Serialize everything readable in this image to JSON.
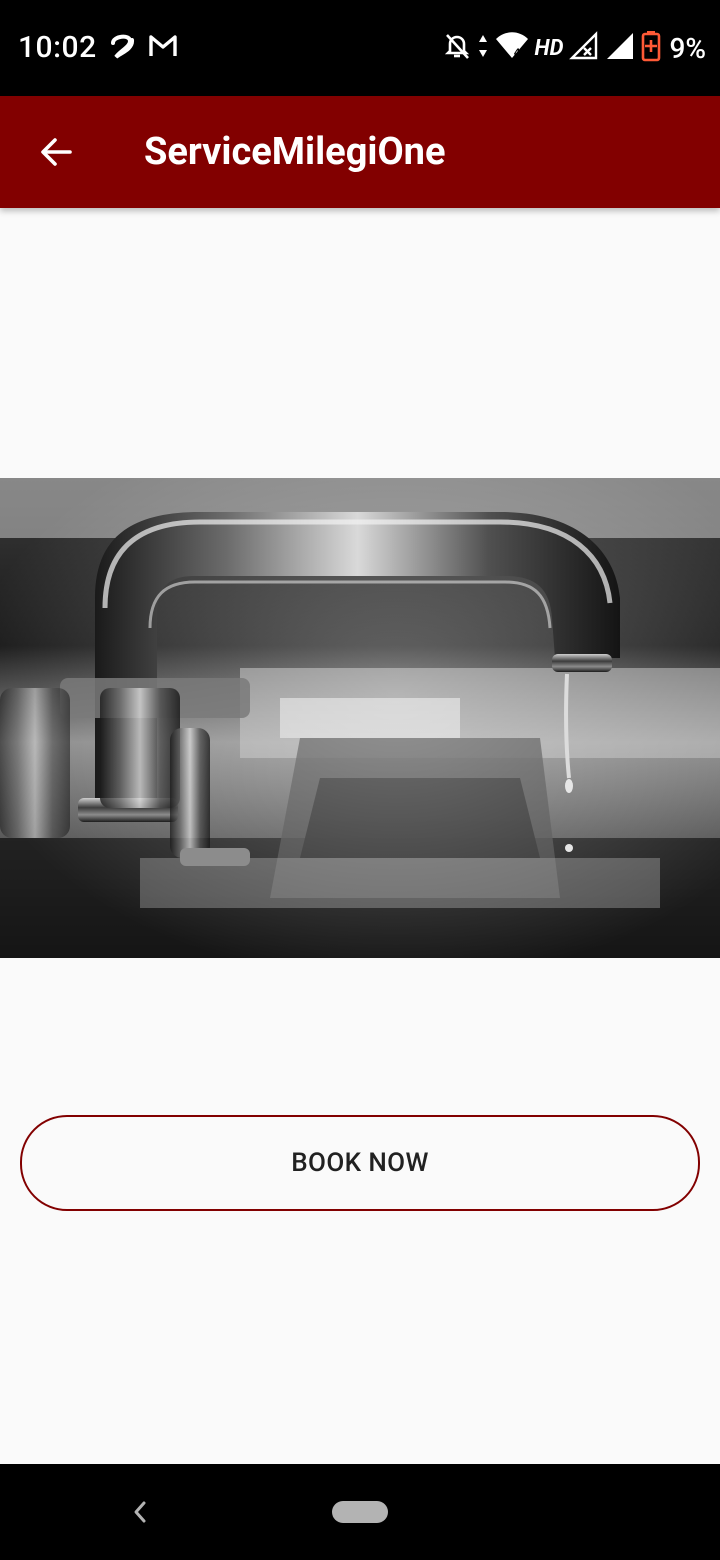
{
  "status_bar": {
    "time": "10:02",
    "network_label": "HD",
    "battery_percent": "9%",
    "icons": [
      "airtel-icon",
      "gmail-icon",
      "mute-bell-icon",
      "data-arrows-icon",
      "wifi-icon",
      "signal-no-service-icon",
      "signal-icon",
      "battery-low-icon"
    ]
  },
  "app_bar": {
    "title": "ServiceMilegiOne",
    "back_icon": "arrow-back-icon",
    "color": "#820000"
  },
  "hero_image": {
    "description_icon": "faucet-photo"
  },
  "actions": {
    "book_now_label": "BOOK NOW",
    "accent_color": "#820000"
  },
  "nav_bar": {
    "icons": [
      "nav-back-icon",
      "nav-home-pill"
    ]
  }
}
